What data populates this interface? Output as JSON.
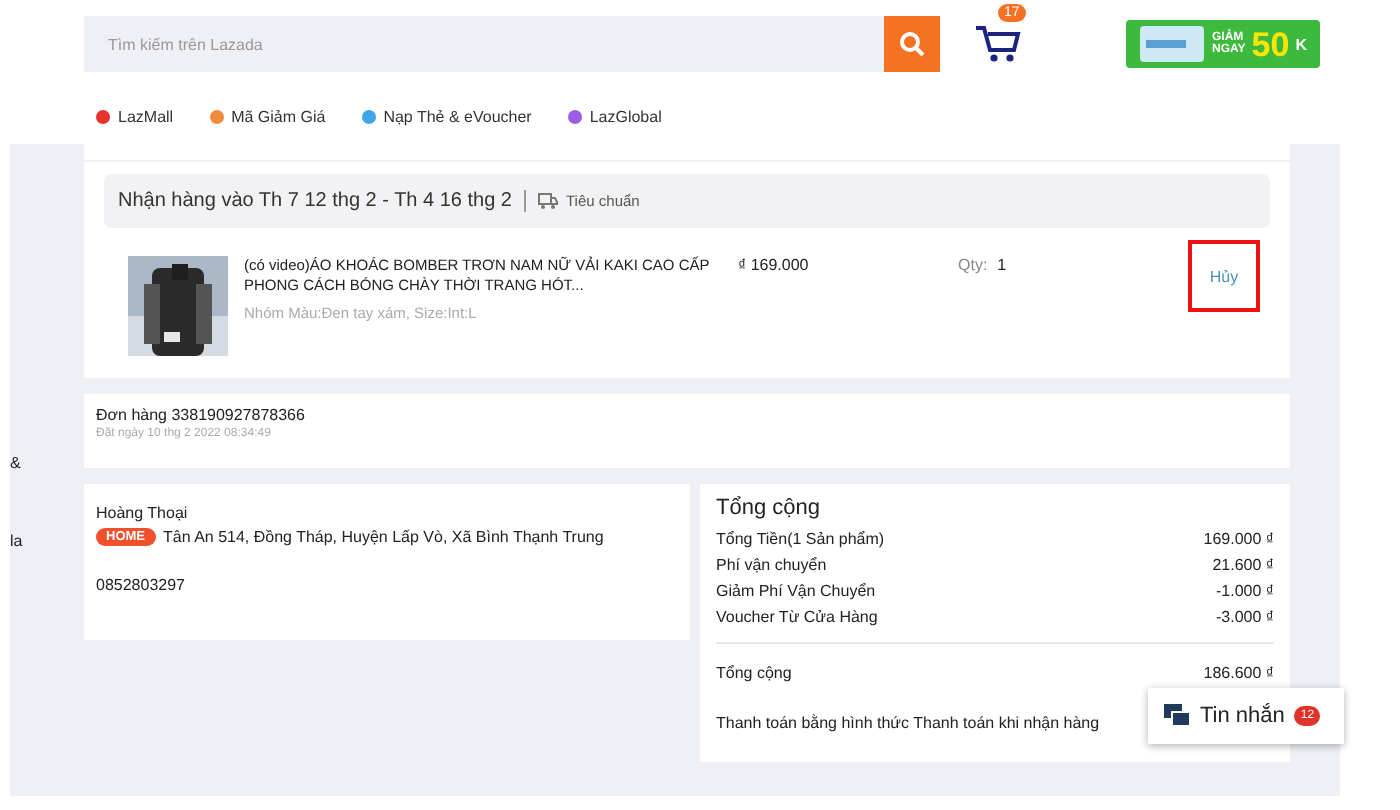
{
  "header": {
    "search": {
      "placeholder": "Tìm kiếm trên Lazada"
    },
    "cart_count": "17",
    "banner": {
      "line_1": "GIẢM",
      "line_2": "NGAY",
      "amount": "50",
      "unit": "K"
    }
  },
  "nav": [
    {
      "label": "LazMall",
      "color": "#e5322d"
    },
    {
      "label": "Mã Giảm Giá",
      "color": "#f08a3c"
    },
    {
      "label": "Nạp Thẻ & eVoucher",
      "color": "#3fa6e8"
    },
    {
      "label": "LazGlobal",
      "color": "#9b5de5"
    }
  ],
  "sidebar_fragments": [
    "&",
    "la"
  ],
  "delivery": {
    "title": "Nhận hàng vào Th 7 12 thg 2 - Th 4 16 thg 2",
    "shipping": "Tiêu chuẩn"
  },
  "item": {
    "name": "(có video)ÁO KHOÁC BOMBER TRƠN NAM NỮ VẢI KAKI CAO CẤP PHONG CÁCH BÓNG CHÀY THỜI TRANG HÓT...",
    "variant": "Nhóm Màu:Đen tay xám, Size:Int:L",
    "price": "₫ 169.000",
    "qty_label": "Qty:",
    "qty": "1",
    "action": "Hủy",
    "highlighted": true
  },
  "order": {
    "number": "Đơn hàng 338190927878366",
    "placed": "Đặt ngày 10 thg 2 2022 08:34:49"
  },
  "address": {
    "name": "Hoàng Thoại",
    "tag": "HOME",
    "address": "Tân An 514, Đồng Tháp, Huyện Lấp Vò, Xã Bình Thạnh Trung",
    "phone": "0852803297"
  },
  "summary": {
    "title": "Tổng cộng",
    "rows": [
      {
        "label": "Tổng Tiền(1 Sản phẩm)",
        "value": "169.000 ₫"
      },
      {
        "label": "Phí vận chuyển",
        "value": "21.600 ₫"
      },
      {
        "label": "Giảm Phí Vận Chuyển",
        "value": "-1.000 ₫"
      },
      {
        "label": "Voucher Từ Cửa Hàng",
        "value": "-3.000 ₫"
      }
    ],
    "total_label": "Tổng cộng",
    "total_value": "186.600 ₫",
    "payment": "Thanh toán bằng hình thức Thanh toán khi nhận hàng"
  },
  "chat": {
    "label": "Tin nhắn",
    "count": "12"
  }
}
